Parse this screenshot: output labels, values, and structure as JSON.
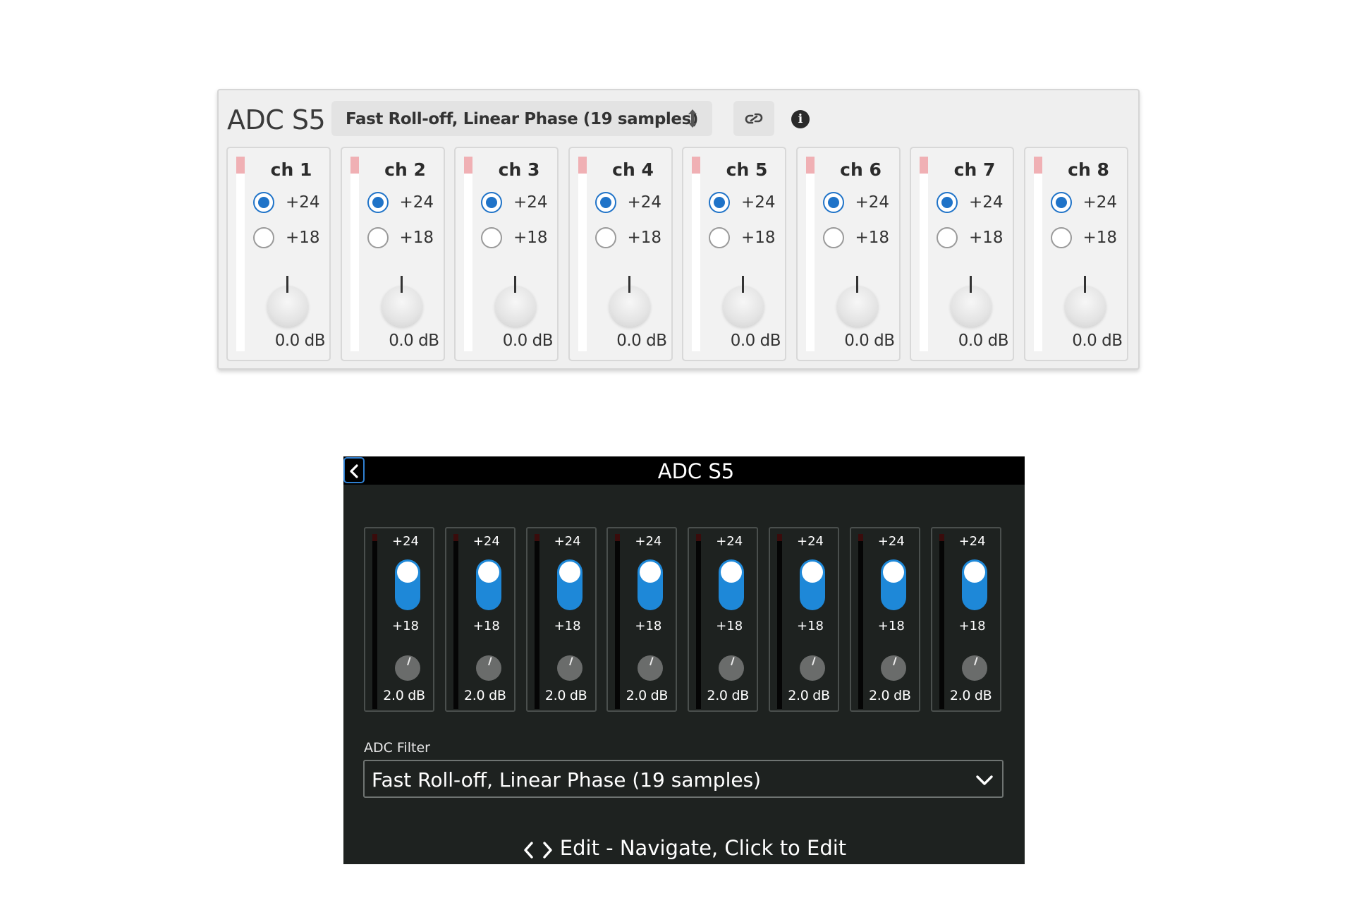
{
  "panel": {
    "title": "ADC S5",
    "filter_value": "Fast Roll-off, Linear Phase (19 samples)",
    "icons": {
      "filter_arrows": "up-down-arrows-icon",
      "link": "link-icon",
      "info": "info-icon"
    },
    "info_glyph": "i",
    "channels": [
      {
        "label": "ch 1",
        "options": [
          "+24",
          "+18"
        ],
        "selected": "+24",
        "gain": "0.0 dB"
      },
      {
        "label": "ch 2",
        "options": [
          "+24",
          "+18"
        ],
        "selected": "+24",
        "gain": "0.0 dB"
      },
      {
        "label": "ch 3",
        "options": [
          "+24",
          "+18"
        ],
        "selected": "+24",
        "gain": "0.0 dB"
      },
      {
        "label": "ch 4",
        "options": [
          "+24",
          "+18"
        ],
        "selected": "+24",
        "gain": "0.0 dB"
      },
      {
        "label": "ch 5",
        "options": [
          "+24",
          "+18"
        ],
        "selected": "+24",
        "gain": "0.0 dB"
      },
      {
        "label": "ch 6",
        "options": [
          "+24",
          "+18"
        ],
        "selected": "+24",
        "gain": "0.0 dB"
      },
      {
        "label": "ch 7",
        "options": [
          "+24",
          "+18"
        ],
        "selected": "+24",
        "gain": "0.0 dB"
      },
      {
        "label": "ch 8",
        "options": [
          "+24",
          "+18"
        ],
        "selected": "+24",
        "gain": "0.0 dB"
      }
    ]
  },
  "device": {
    "title": "ADC S5",
    "channels": [
      {
        "top_label": "+24",
        "bottom_label": "+18",
        "selected": "+24",
        "gain": "2.0 dB"
      },
      {
        "top_label": "+24",
        "bottom_label": "+18",
        "selected": "+24",
        "gain": "2.0 dB"
      },
      {
        "top_label": "+24",
        "bottom_label": "+18",
        "selected": "+24",
        "gain": "2.0 dB"
      },
      {
        "top_label": "+24",
        "bottom_label": "+18",
        "selected": "+24",
        "gain": "2.0 dB"
      },
      {
        "top_label": "+24",
        "bottom_label": "+18",
        "selected": "+24",
        "gain": "2.0 dB"
      },
      {
        "top_label": "+24",
        "bottom_label": "+18",
        "selected": "+24",
        "gain": "2.0 dB"
      },
      {
        "top_label": "+24",
        "bottom_label": "+18",
        "selected": "+24",
        "gain": "2.0 dB"
      },
      {
        "top_label": "+24",
        "bottom_label": "+18",
        "selected": "+24",
        "gain": "2.0 dB"
      }
    ],
    "filter_caption": "ADC Filter",
    "filter_value": "Fast Roll-off, Linear Phase (19 samples)",
    "footer_hint": "Edit - Navigate, Click to Edit"
  },
  "colors": {
    "accent_blue": "#1f73c8",
    "toggle_blue": "#1e88d8",
    "clip_indicator": "#f0b0b4",
    "device_background": "#1e2220"
  }
}
